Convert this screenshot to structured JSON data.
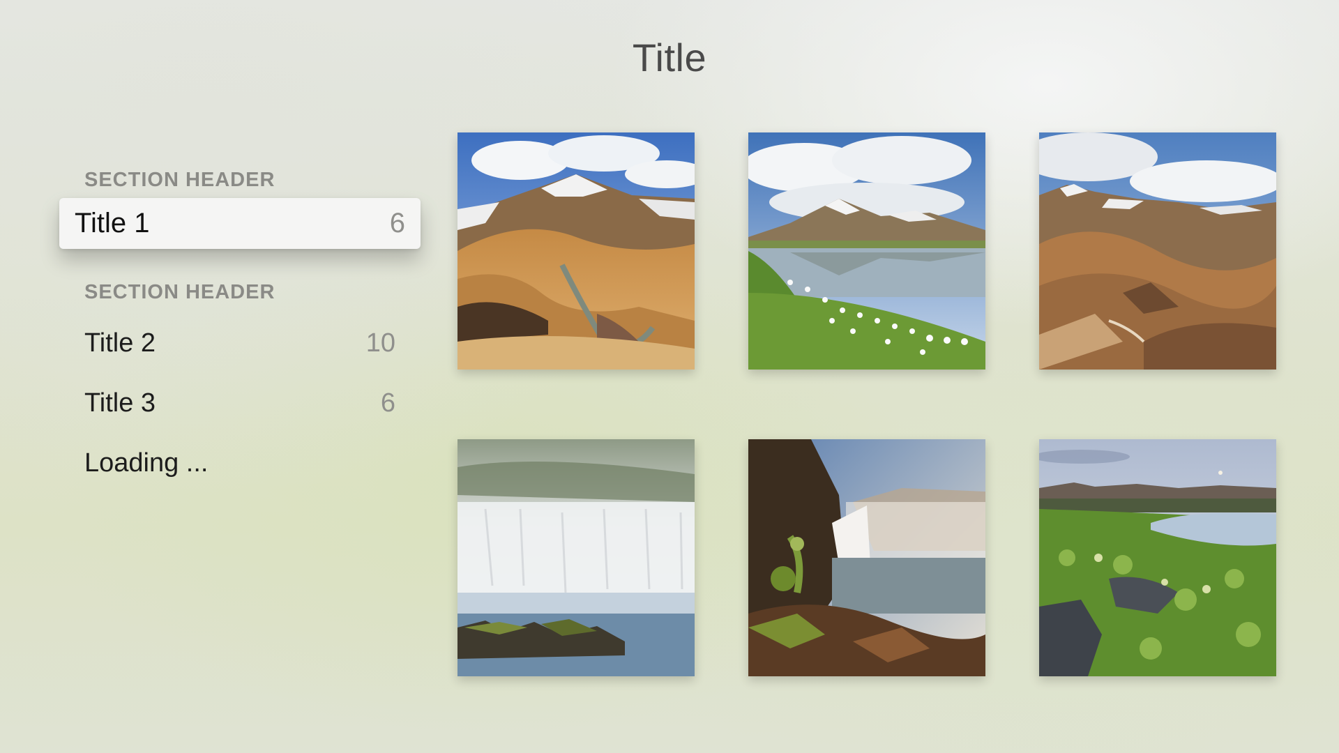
{
  "header": {
    "title": "Title"
  },
  "sidebar": {
    "sections": [
      {
        "header": "SECTION HEADER",
        "items": [
          {
            "label": "Title 1",
            "count": "6",
            "focused": true
          }
        ]
      },
      {
        "header": "SECTION HEADER",
        "items": [
          {
            "label": "Title 2",
            "count": "10"
          },
          {
            "label": "Title 3",
            "count": "6"
          },
          {
            "label": "Loading ...",
            "count": ""
          }
        ]
      }
    ]
  },
  "grid": {
    "photos": [
      {
        "subject": "colorful-mountains"
      },
      {
        "subject": "mountain-lake-cotton-grass"
      },
      {
        "subject": "rhyolite-mountains"
      },
      {
        "subject": "waterfall-mist"
      },
      {
        "subject": "waterfall-cliff"
      },
      {
        "subject": "lava-field-pond"
      }
    ]
  }
}
